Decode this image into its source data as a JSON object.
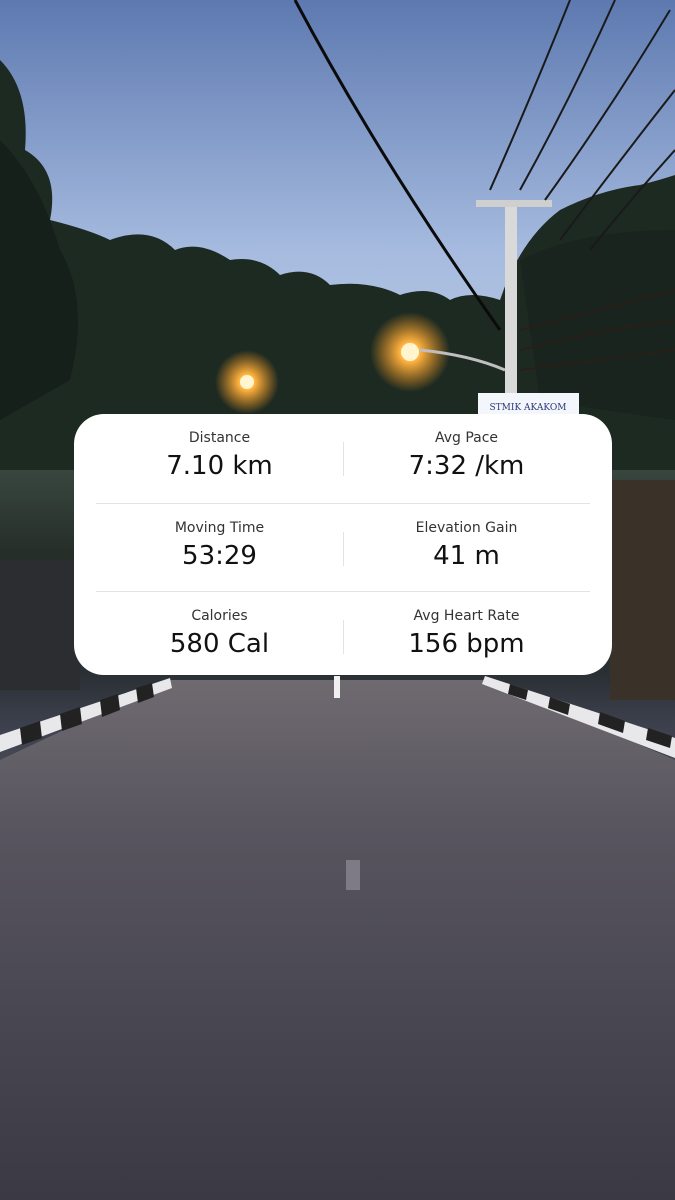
{
  "background": {
    "sign_text": "STMIK AKAKOM"
  },
  "stats": [
    {
      "label": "Distance",
      "value": "7.10 km"
    },
    {
      "label": "Avg Pace",
      "value": "7:32 /km"
    },
    {
      "label": "Moving Time",
      "value": "53:29"
    },
    {
      "label": "Elevation Gain",
      "value": "41 m"
    },
    {
      "label": "Calories",
      "value": "580 Cal"
    },
    {
      "label": "Avg Heart Rate",
      "value": "156 bpm"
    }
  ],
  "colors": {
    "card": "#ffffff",
    "text": "#111111",
    "label": "#333333",
    "divider": "#e3e3e3"
  }
}
